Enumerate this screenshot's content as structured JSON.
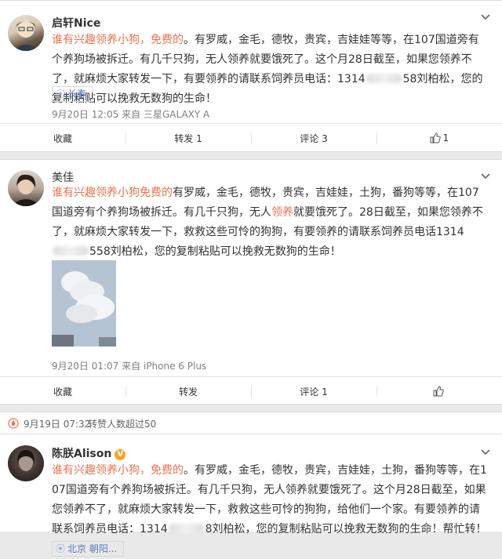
{
  "post1": {
    "author": "启轩Nice",
    "hl": "谁有兴趣领养小狗，免费的",
    "body_a": "。有罗威，金毛，德牧，贵宾，吉娃娃等等，在107国道旁有个养狗场被拆迁。有几千只狗，无人领养就要饿死了。这个月28日截至，如果您领养不了，就麻烦大家转发一下，有要领养的请联系饲养员电话：1314",
    "body_b": "58刘柏松，您的复制粘贴可以挽救无数狗的生命！",
    "location": "长春",
    "time": "9月20日 12:05",
    "source_prefix": "来自",
    "source": "三星GALAXY A",
    "actions": {
      "fav": "收藏",
      "repost": "转发 1",
      "comment": "评论 3",
      "like": "1"
    }
  },
  "post2": {
    "author": "美佳",
    "hl": "谁有兴趣领养小狗免费的",
    "body_a": "有罗威，金毛，德牧，贵宾，吉娃娃，土狗，番狗等等，在107国道旁有个养狗场被拆迁。有几千只狗，无人",
    "hl2": "领养",
    "body_b": "就要饿死了。28日截至，如果您领养不了，就麻烦大家转发一下，救救这些可怜的狗狗，有要领养的请联系饲养员电话1314",
    "body_c": "558刘柏松，您的复制粘贴可以挽救无数狗的生命！",
    "time": "9月20日 01:07",
    "source_prefix": "来自",
    "source": "iPhone 6 Plus",
    "actions": {
      "fav": "收藏",
      "repost": "转发",
      "comment": "评论 1",
      "like": ""
    }
  },
  "banner": {
    "date": "9月19日 07:32",
    "text": "转赞人数超过50"
  },
  "post3": {
    "author": "陈朕Alison",
    "vip": "V",
    "hl": "谁有兴趣领养小狗，免费的",
    "body_a": "。有罗威，金毛，德牧，贵宾，吉娃娃，土狗，番狗等等，在107国道旁有个养狗场被拆迁。有几千只狗，无人领养就要饿死了。这个月28日截至，如果您领养不了，就麻烦大家转发一下，救救这些可怜的狗狗，给他们一个家。有要领养的请联系饲养员电话：1314",
    "body_b": "8刘柏松，您的复制粘贴可以挽救无数狗的生命！帮忙转！",
    "location": "北京 朝阳..."
  },
  "colors": {
    "highlight": "#eb7350",
    "link": "#5b7bbd",
    "vip": "#f5a623"
  }
}
